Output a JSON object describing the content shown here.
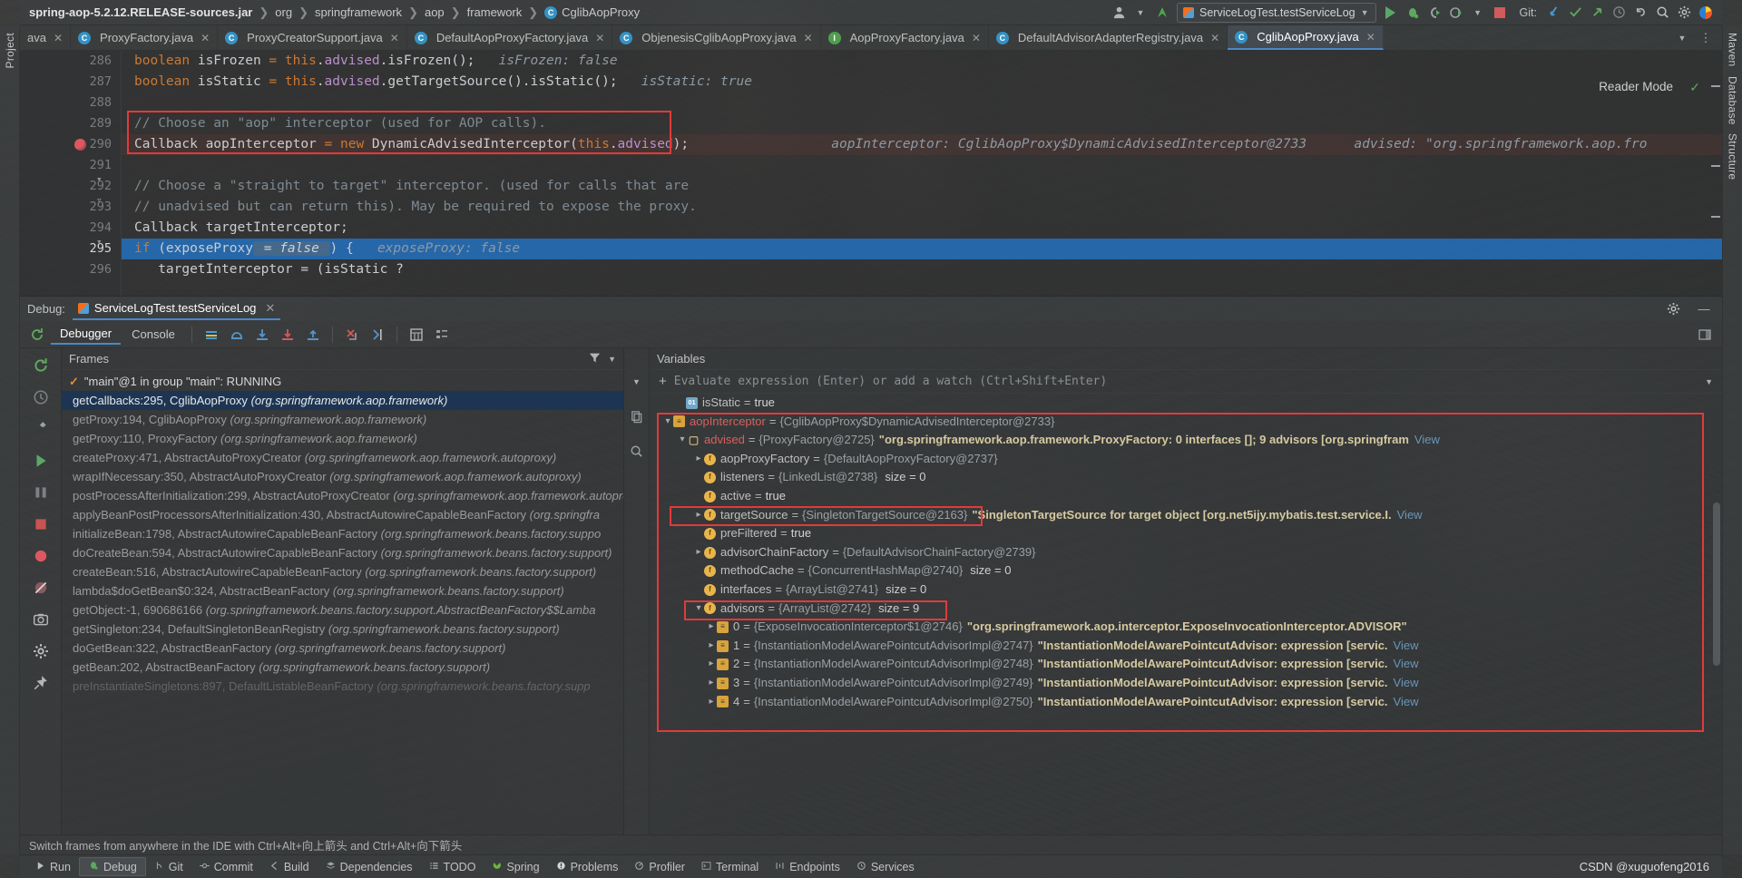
{
  "window": {
    "breadcrumb": [
      {
        "label": "spring-aop-5.2.12.RELEASE-sources.jar",
        "bold": true,
        "icon": ""
      },
      {
        "label": "org",
        "bold": false,
        "icon": ""
      },
      {
        "label": "springframework",
        "bold": false,
        "icon": ""
      },
      {
        "label": "aop",
        "bold": false,
        "icon": ""
      },
      {
        "label": "framework",
        "bold": false,
        "icon": ""
      },
      {
        "label": "CglibAopProxy",
        "bold": false,
        "icon": "class-badge"
      }
    ],
    "run_config": "ServiceLogTest.testServiceLog",
    "git_label": "Git:",
    "toolbar_icons": [
      "user-avatar-icon",
      "chevron-down-icon",
      "update-project-icon",
      "run-icon",
      "debug-icon",
      "run-coverage-icon",
      "profiler-icon",
      "chevron-down-icon",
      "stop-icon",
      "git-pull-icon",
      "git-commit-check-icon",
      "git-push-icon",
      "history-icon",
      "undo-icon",
      "search-icon",
      "settings-icon",
      "idea-logo-icon"
    ]
  },
  "editor_tabs": [
    {
      "label": "ProxyFactory.java",
      "icon": "class-icon",
      "active": false
    },
    {
      "label": "ProxyCreatorSupport.java",
      "icon": "class-icon",
      "active": false
    },
    {
      "label": "DefaultAopProxyFactory.java",
      "icon": "class-icon",
      "active": false
    },
    {
      "label": "ObjenesisCglibAopProxy.java",
      "icon": "class-icon",
      "active": false
    },
    {
      "label": "AopProxyFactory.java",
      "icon": "interface-icon",
      "active": false
    },
    {
      "label": "DefaultAdvisorAdapterRegistry.java",
      "icon": "class-icon",
      "active": false
    },
    {
      "label": "CglibAopProxy.java",
      "icon": "class-icon",
      "active": true
    }
  ],
  "editor": {
    "reader_mode": "Reader Mode",
    "first_line_number": 286,
    "current_line": 295,
    "breakpoint_line": 290,
    "lines": [
      {
        "num": 286,
        "segments": [
          {
            "t": "      ",
            "c": ""
          },
          {
            "t": "boolean",
            "c": "k"
          },
          {
            "t": " isFrozen ",
            "c": ""
          },
          {
            "t": "=",
            "c": "k"
          },
          {
            "t": " ",
            "c": ""
          },
          {
            "t": "this",
            "c": "k"
          },
          {
            "t": ".",
            "c": ""
          },
          {
            "t": "advised",
            "c": "fld"
          },
          {
            "t": ".isFrozen();",
            "c": ""
          },
          {
            "t": "   isFrozen: false",
            "c": "hint"
          }
        ]
      },
      {
        "num": 287,
        "segments": [
          {
            "t": "      ",
            "c": ""
          },
          {
            "t": "boolean",
            "c": "k"
          },
          {
            "t": " isStatic ",
            "c": ""
          },
          {
            "t": "=",
            "c": "k"
          },
          {
            "t": " ",
            "c": ""
          },
          {
            "t": "this",
            "c": "k"
          },
          {
            "t": ".",
            "c": ""
          },
          {
            "t": "advised",
            "c": "fld"
          },
          {
            "t": ".getTargetSource().isStatic();",
            "c": ""
          },
          {
            "t": "   isStatic: true",
            "c": "hint"
          }
        ]
      },
      {
        "num": 288,
        "segments": []
      },
      {
        "num": 289,
        "segments": [
          {
            "t": "      ",
            "c": ""
          },
          {
            "t": "// Choose an \"aop\" interceptor (used for AOP calls).",
            "c": "cm"
          }
        ]
      },
      {
        "num": 290,
        "segments": [
          {
            "t": "      ",
            "c": ""
          },
          {
            "t": "Callback",
            "c": ""
          },
          {
            "t": " aopInterceptor ",
            "c": ""
          },
          {
            "t": "=",
            "c": "k"
          },
          {
            "t": " ",
            "c": ""
          },
          {
            "t": "new",
            "c": "k"
          },
          {
            "t": " DynamicAdvisedInterceptor(",
            "c": ""
          },
          {
            "t": "this",
            "c": "k"
          },
          {
            "t": ".",
            "c": ""
          },
          {
            "t": "advised",
            "c": "fld"
          },
          {
            "t": ");",
            "c": ""
          }
        ]
      },
      {
        "num": 291,
        "segments": []
      },
      {
        "num": 292,
        "segments": [
          {
            "t": "      ",
            "c": ""
          },
          {
            "t": "// Choose a \"straight to target\" interceptor. (used for calls that are",
            "c": "cm"
          }
        ]
      },
      {
        "num": 293,
        "segments": [
          {
            "t": "      ",
            "c": ""
          },
          {
            "t": "// unadvised but can return this). May be required to expose the proxy.",
            "c": "cm"
          }
        ]
      },
      {
        "num": 294,
        "segments": [
          {
            "t": "      ",
            "c": ""
          },
          {
            "t": "Callback",
            "c": ""
          },
          {
            "t": " targetInterceptor;",
            "c": ""
          }
        ]
      },
      {
        "num": 295,
        "segments": [
          {
            "t": "      ",
            "c": ""
          },
          {
            "t": "if",
            "c": "k"
          },
          {
            "t": " (exposeProxy",
            "c": ""
          },
          {
            "t": " = false ",
            "c": "inlval"
          },
          {
            "t": ") {",
            "c": ""
          },
          {
            "t": "   exposeProxy: false",
            "c": "hint"
          }
        ]
      },
      {
        "num": 296,
        "segments": [
          {
            "t": "         ",
            "c": ""
          },
          {
            "t": "targetInterceptor = (isStatic ?",
            "c": ""
          }
        ]
      }
    ],
    "inline_hint_290_a": "aopInterceptor: CglibAopProxy$DynamicAdvisedInterceptor@2733",
    "inline_hint_290_b": "advised: \"org.springframework.aop.fra"
  },
  "debug": {
    "title": "Debug:",
    "session": "ServiceLogTest.testServiceLog",
    "tabs": [
      {
        "label": "Debugger",
        "selected": true
      },
      {
        "label": "Console",
        "selected": false
      }
    ],
    "toolbar_icons": [
      "rerun-icon",
      "show-execution-point-icon",
      "step-over-icon",
      "step-into-icon",
      "force-step-into-icon",
      "step-out-icon",
      "drop-frame-icon",
      "run-to-cursor-icon",
      "evaluate-expression-icon",
      "layout-icon"
    ],
    "header_icons": [
      "settings-icon",
      "minimize-icon",
      "restore-layout-icon"
    ],
    "left_rail_icons": [
      "rerun-session-icon",
      "resume-program-icon",
      "pause-icon",
      "stop-icon",
      "view-breakpoints-icon",
      "mute-breakpoints-icon",
      "camera-icon",
      "settings-icon",
      "pin-icon"
    ],
    "mid_rail_icons": [
      "copy-icon",
      "inspect-icon"
    ],
    "frames": {
      "header": "Frames",
      "header_icons": [
        "filter-icon",
        "chevron-down-icon"
      ],
      "thread": "\"main\"@1 in group \"main\": RUNNING",
      "items": [
        {
          "text": "getCallbacks:295, CglibAopProxy ",
          "pkg": "(org.springframework.aop.framework)",
          "selected": true
        },
        {
          "text": "getProxy:194, CglibAopProxy ",
          "pkg": "(org.springframework.aop.framework)",
          "selected": false
        },
        {
          "text": "getProxy:110, ProxyFactory ",
          "pkg": "(org.springframework.aop.framework)",
          "selected": false
        },
        {
          "text": "createProxy:471, AbstractAutoProxyCreator ",
          "pkg": "(org.springframework.aop.framework.autoproxy)",
          "selected": false
        },
        {
          "text": "wrapIfNecessary:350, AbstractAutoProxyCreator ",
          "pkg": "(org.springframework.aop.framework.autoproxy)",
          "selected": false
        },
        {
          "text": "postProcessAfterInitialization:299, AbstractAutoProxyCreator ",
          "pkg": "(org.springframework.aop.framework.autoproxy)",
          "selected": false
        },
        {
          "text": "applyBeanPostProcessorsAfterInitialization:430, AbstractAutowireCapableBeanFactory ",
          "pkg": "(org.springfra",
          "selected": false
        },
        {
          "text": "initializeBean:1798, AbstractAutowireCapableBeanFactory ",
          "pkg": "(org.springframework.beans.factory.suppo",
          "selected": false
        },
        {
          "text": "doCreateBean:594, AbstractAutowireCapableBeanFactory ",
          "pkg": "(org.springframework.beans.factory.support)",
          "selected": false
        },
        {
          "text": "createBean:516, AbstractAutowireCapableBeanFactory ",
          "pkg": "(org.springframework.beans.factory.support)",
          "selected": false
        },
        {
          "text": "lambda$doGetBean$0:324, AbstractBeanFactory ",
          "pkg": "(org.springframework.beans.factory.support)",
          "selected": false
        },
        {
          "text": "getObject:-1, 690686166 ",
          "pkg": "(org.springframework.beans.factory.support.AbstractBeanFactory$$Lamba",
          "selected": false
        },
        {
          "text": "getSingleton:234, DefaultSingletonBeanRegistry ",
          "pkg": "(org.springframework.beans.factory.support)",
          "selected": false
        },
        {
          "text": "doGetBean:322, AbstractBeanFactory ",
          "pkg": "(org.springframework.beans.factory.support)",
          "selected": false
        },
        {
          "text": "getBean:202, AbstractBeanFactory ",
          "pkg": "(org.springframework.beans.factory.support)",
          "selected": false
        },
        {
          "text": "preInstantiateSingletons:897, DefaultListableBeanFactory ",
          "pkg": "(org.springframework.beans.factory.supp",
          "selected": false
        }
      ]
    },
    "variables": {
      "header": "Variables",
      "watch_placeholder": "Evaluate expression (Enter) or add a watch (Ctrl+Shift+Enter)",
      "rows": [
        {
          "indent": 1,
          "arrow": "",
          "icon": "prim",
          "glyph": "01",
          "name": "isStatic",
          "eq": "=",
          "ref": "",
          "val": "true",
          "str": "",
          "size": "",
          "link": ""
        },
        {
          "indent": 0,
          "arrow": "v",
          "icon": "list",
          "glyph": "≡",
          "name": "aopInterceptor",
          "name_red": true,
          "eq": "=",
          "ref": "{CglibAopProxy$DynamicAdvisedInterceptor@2733}",
          "val": "",
          "str": "",
          "size": "",
          "link": ""
        },
        {
          "indent": 1,
          "arrow": "v",
          "icon": "proxy",
          "glyph": "⛔",
          "name": "advised",
          "name_red": true,
          "eq": "=",
          "ref": "{ProxyFactory@2725}",
          "val": "",
          "str": "\"org.springframework.aop.framework.ProxyFactory: 0 interfaces []; 9 advisors [org.springfram",
          "size": "",
          "link": "View"
        },
        {
          "indent": 2,
          "arrow": ">",
          "icon": "field",
          "glyph": "f",
          "name": "aopProxyFactory",
          "eq": "=",
          "ref": "{DefaultAopProxyFactory@2737}",
          "val": "",
          "str": "",
          "size": "",
          "link": ""
        },
        {
          "indent": 2,
          "arrow": "",
          "icon": "field",
          "glyph": "f",
          "name": "listeners",
          "eq": "=",
          "ref": "{LinkedList@2738}",
          "val": "",
          "str": "",
          "size": "size = 0",
          "link": ""
        },
        {
          "indent": 2,
          "arrow": "",
          "icon": "field",
          "glyph": "f",
          "name": "active",
          "eq": "=",
          "ref": "",
          "val": "true",
          "str": "",
          "size": "",
          "link": ""
        },
        {
          "indent": 2,
          "arrow": ">",
          "icon": "field",
          "glyph": "f",
          "name": "targetSource",
          "eq": "=",
          "ref": "{SingletonTargetSource@2163}",
          "val": "",
          "str": "\"SingletonTargetSource for target object [org.net5ijy.mybatis.test.service.I.",
          "size": "",
          "link": "View"
        },
        {
          "indent": 2,
          "arrow": "",
          "icon": "field",
          "glyph": "f",
          "name": "preFiltered",
          "eq": "=",
          "ref": "",
          "val": "true",
          "str": "",
          "size": "",
          "link": ""
        },
        {
          "indent": 2,
          "arrow": ">",
          "icon": "field",
          "glyph": "f",
          "name": "advisorChainFactory",
          "eq": "=",
          "ref": "{DefaultAdvisorChainFactory@2739}",
          "val": "",
          "str": "",
          "size": "",
          "link": ""
        },
        {
          "indent": 2,
          "arrow": "",
          "icon": "field",
          "glyph": "f",
          "name": "methodCache",
          "eq": "=",
          "ref": "{ConcurrentHashMap@2740}",
          "val": "",
          "str": "",
          "size": "size = 0",
          "link": ""
        },
        {
          "indent": 2,
          "arrow": "",
          "icon": "field",
          "glyph": "f",
          "name": "interfaces",
          "eq": "=",
          "ref": "{ArrayList@2741}",
          "val": "",
          "str": "",
          "size": "size = 0",
          "link": ""
        },
        {
          "indent": 2,
          "arrow": "v",
          "icon": "field",
          "glyph": "f",
          "name": "advisors",
          "eq": "=",
          "ref": "{ArrayList@2742}",
          "val": "",
          "str": "",
          "size": "size = 9",
          "link": ""
        },
        {
          "indent": 3,
          "arrow": ">",
          "icon": "list",
          "glyph": "≡",
          "name": "0",
          "eq": "=",
          "ref": "{ExposeInvocationInterceptor$1@2746}",
          "val": "",
          "str": "\"org.springframework.aop.interceptor.ExposeInvocationInterceptor.ADVISOR\"",
          "size": "",
          "link": ""
        },
        {
          "indent": 3,
          "arrow": ">",
          "icon": "list",
          "glyph": "≡",
          "name": "1",
          "eq": "=",
          "ref": "{InstantiationModelAwarePointcutAdvisorImpl@2747}",
          "val": "",
          "str": "\"InstantiationModelAwarePointcutAdvisor: expression [servic.",
          "size": "",
          "link": "View"
        },
        {
          "indent": 3,
          "arrow": ">",
          "icon": "list",
          "glyph": "≡",
          "name": "2",
          "eq": "=",
          "ref": "{InstantiationModelAwarePointcutAdvisorImpl@2748}",
          "val": "",
          "str": "\"InstantiationModelAwarePointcutAdvisor: expression [servic.",
          "size": "",
          "link": "View"
        },
        {
          "indent": 3,
          "arrow": ">",
          "icon": "list",
          "glyph": "≡",
          "name": "3",
          "eq": "=",
          "ref": "{InstantiationModelAwarePointcutAdvisorImpl@2749}",
          "val": "",
          "str": "\"InstantiationModelAwarePointcutAdvisor: expression [servic.",
          "size": "",
          "link": "View"
        },
        {
          "indent": 3,
          "arrow": ">",
          "icon": "list",
          "glyph": "≡",
          "name": "4",
          "eq": "=",
          "ref": "{InstantiationModelAwarePointcutAdvisorImpl@2750}",
          "val": "",
          "str": "\"InstantiationModelAwarePointcutAdvisor: expression [servic.",
          "size": "",
          "link": "View"
        }
      ]
    }
  },
  "hintbar": "Switch frames from anywhere in the IDE with Ctrl+Alt+向上箭头 and Ctrl+Alt+向下箭头",
  "statusbar": {
    "items": [
      {
        "label": "Run",
        "icon": "run-icon",
        "active": false
      },
      {
        "label": "Debug",
        "icon": "debug-icon",
        "active": true
      },
      {
        "label": "Git",
        "icon": "git-icon",
        "active": false
      },
      {
        "label": "Commit",
        "icon": "commit-icon",
        "active": false
      },
      {
        "label": "Build",
        "icon": "build-icon",
        "active": false
      },
      {
        "label": "Dependencies",
        "icon": "dependencies-icon",
        "active": false
      },
      {
        "label": "TODO",
        "icon": "todo-icon",
        "active": false
      },
      {
        "label": "Spring",
        "icon": "spring-icon",
        "active": false
      },
      {
        "label": "Problems",
        "icon": "problems-icon",
        "active": false
      },
      {
        "label": "Profiler",
        "icon": "profiler-icon",
        "active": false
      },
      {
        "label": "Terminal",
        "icon": "terminal-icon",
        "active": false
      },
      {
        "label": "Endpoints",
        "icon": "endpoints-icon",
        "active": false
      },
      {
        "label": "Services",
        "icon": "services-icon",
        "active": false
      }
    ],
    "watermark": "CSDN @xuguofeng2016"
  },
  "side_strips": {
    "left": [
      "Project",
      "Maven"
    ],
    "right": [
      "Database",
      "Structure"
    ]
  },
  "colors": {
    "accent_blue": "#4a88c7",
    "selection_blue": "#2374c7",
    "highlight_red": "#e23a3a",
    "green_run": "#59a869",
    "breakpoint_red": "#db5860"
  }
}
